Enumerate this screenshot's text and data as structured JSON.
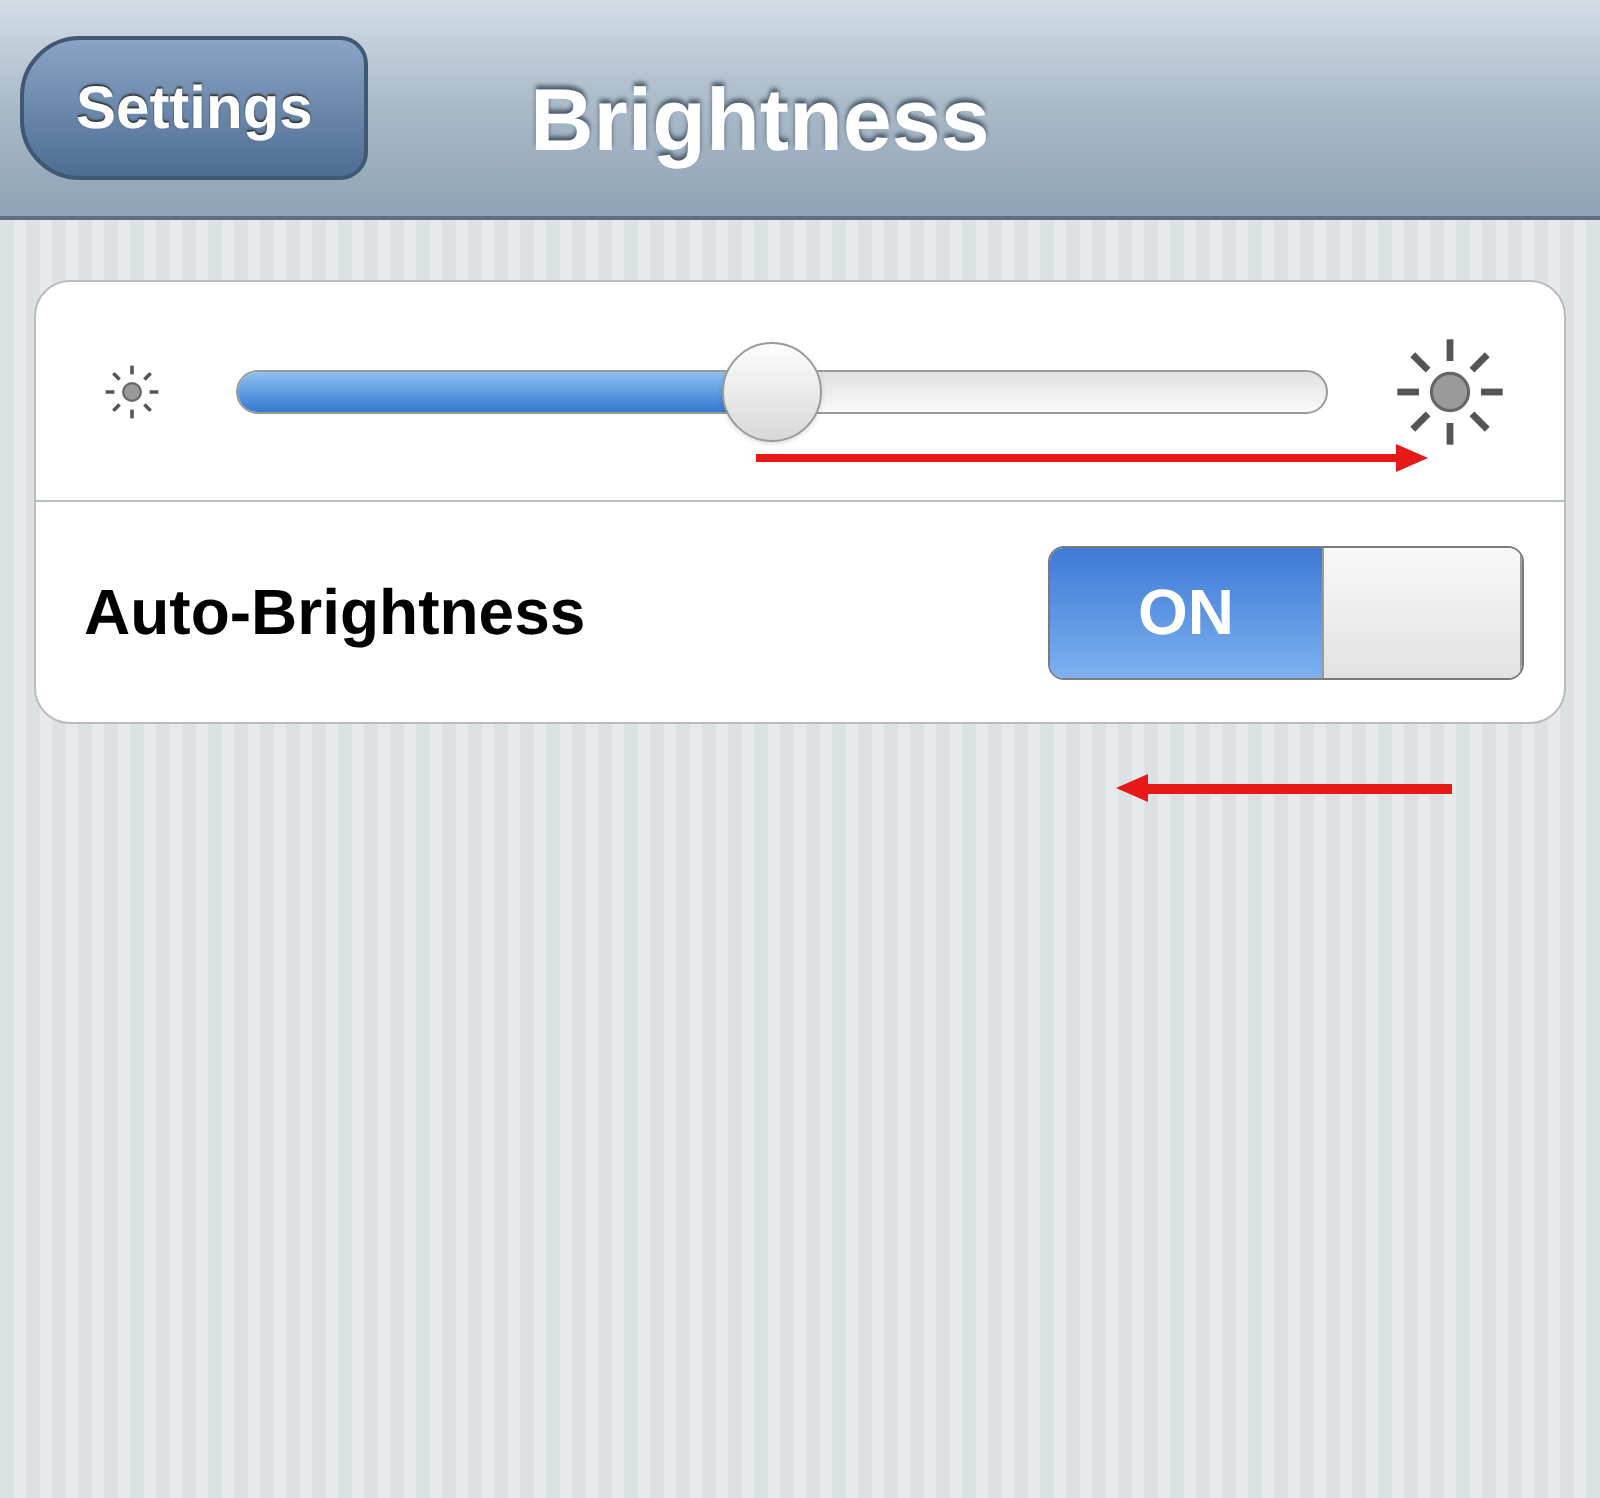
{
  "nav": {
    "back_button": "Settings",
    "title": "Brightness"
  },
  "brightness": {
    "level": 0.49
  },
  "auto_brightness": {
    "label": "Auto-Brightness",
    "on": true,
    "switch_text": "ON"
  }
}
